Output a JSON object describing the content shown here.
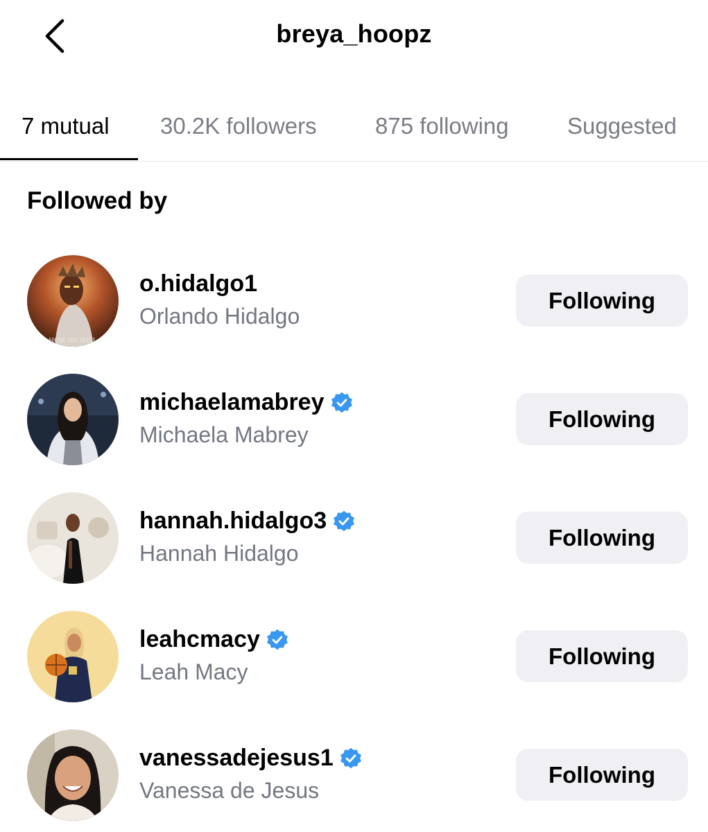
{
  "header": {
    "title": "breya_hoopz",
    "back_icon": "chevron-left-icon"
  },
  "tabs": [
    {
      "label": "7 mutual",
      "active": true
    },
    {
      "label": "30.2K followers",
      "active": false
    },
    {
      "label": "875 following",
      "active": false
    },
    {
      "label": "Suggested",
      "active": false
    }
  ],
  "section": {
    "title": "Followed by"
  },
  "users": [
    {
      "username": "o.hidalgo1",
      "name": "Orlando Hidalgo",
      "verified": false,
      "button": "Following",
      "avatar_caption": "HOW HE WILL"
    },
    {
      "username": "michaelamabrey",
      "name": "Michaela Mabrey",
      "verified": true,
      "button": "Following"
    },
    {
      "username": "hannah.hidalgo3",
      "name": "Hannah Hidalgo",
      "verified": true,
      "button": "Following"
    },
    {
      "username": "leahcmacy",
      "name": "Leah Macy",
      "verified": true,
      "button": "Following"
    },
    {
      "username": "vanessadejesus1",
      "name": "Vanessa de Jesus",
      "verified": true,
      "button": "Following"
    }
  ],
  "colors": {
    "verified_blue": "#3897f0",
    "secondary_text": "#737780",
    "button_bg": "#efeff4",
    "divider": "#e6e6e6"
  }
}
